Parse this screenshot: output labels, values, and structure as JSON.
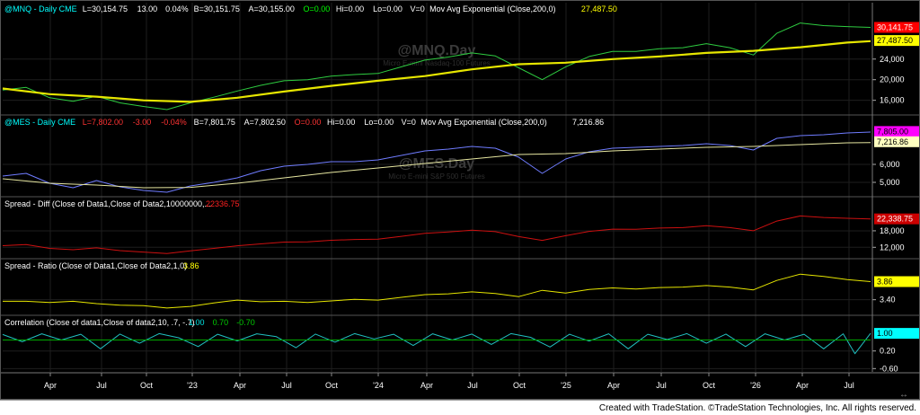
{
  "chart_data": {
    "type": "line",
    "months": [
      "Apr",
      "Jul",
      "Oct",
      "'23",
      "Apr",
      "Jul",
      "Oct",
      "'24",
      "Apr",
      "Jul",
      "Oct",
      "'25",
      "Apr",
      "Jul",
      "Oct",
      "'26",
      "Apr",
      "Jul"
    ],
    "panels": [
      {
        "title": "@MNQ - Daily  CME",
        "stats": [
          {
            "text": "L=30,154.75",
            "color": "#ffffff"
          },
          {
            "text": "13.00",
            "color": "#ffffff"
          },
          {
            "text": "0.04%",
            "color": "#ffffff"
          },
          {
            "text": "B=30,151.75",
            "color": "#ffffff"
          },
          {
            "text": "A=30,155.00",
            "color": "#ffffff"
          },
          {
            "text": "O=0.00",
            "color": "#00ff00"
          },
          {
            "text": "Hi=0.00",
            "color": "#ffffff"
          },
          {
            "text": "Lo=0.00",
            "color": "#ffffff"
          },
          {
            "text": "V=0",
            "color": "#ffffff"
          },
          {
            "text": "Mov Avg Exponential (Close,200,0)",
            "color": "#ffffff"
          },
          {
            "text": "27,487.50",
            "color": "#ffff00"
          }
        ],
        "watermark": "@MNQ.Day",
        "watermark_sub": "Micro E-mini Nasdaq-100 Futures",
        "series": [
          {
            "name": "@MNQ",
            "color": "#2ecc40",
            "x": [
              0,
              6,
              12,
              18,
              24,
              30,
              36,
              42,
              48,
              54,
              60,
              66,
              72,
              78,
              84,
              90,
              96,
              102,
              108,
              114,
              120,
              126,
              132,
              138,
              144,
              150,
              156,
              162,
              168,
              174,
              180,
              186,
              192,
              198,
              204,
              210,
              216,
              222
            ],
            "y": [
              18000,
              18500,
              16500,
              15800,
              16800,
              15500,
              14800,
              14200,
              15500,
              16600,
              17800,
              18900,
              19800,
              20000,
              20700,
              21000,
              21200,
              22500,
              23800,
              24400,
              25200,
              24600,
              22300,
              20000,
              22500,
              24500,
              25500,
              25500,
              26000,
              26200,
              27000,
              26200,
              24800,
              29000,
              31000,
              30500,
              30300,
              30150
            ]
          },
          {
            "name": "Mov Avg Exponential (Close,200,0)",
            "color": "#e6e600",
            "x": [
              0,
              12,
              24,
              36,
              48,
              60,
              72,
              84,
              96,
              108,
              120,
              132,
              144,
              156,
              168,
              180,
              192,
              204,
              216,
              222
            ],
            "y": [
              18300,
              17200,
              16700,
              16000,
              15700,
              16500,
              17700,
              18800,
              19800,
              20700,
              22000,
              23000,
              23300,
              24000,
              24500,
              25200,
              25600,
              26300,
              27200,
              27487.5
            ]
          }
        ],
        "ylim": [
          13500,
          32500
        ],
        "ticks": [
          {
            "label": "24,000",
            "v": 24000
          },
          {
            "label": "20,000",
            "v": 20000
          },
          {
            "label": "16,000",
            "v": 16000
          }
        ],
        "boxes": [
          {
            "text": "30,141.75",
            "v": 30150,
            "bg": "#ff0000",
            "fg": "#ffffff"
          },
          {
            "text": "27,487.50",
            "v": 27600,
            "bg": "#ffff00",
            "fg": "#000000"
          }
        ]
      },
      {
        "title": "@MES - Daily  CME",
        "stats": [
          {
            "text": "L=7,802.00",
            "color": "#ff3333"
          },
          {
            "text": "-3.00",
            "color": "#ff3333"
          },
          {
            "text": "-0.04%",
            "color": "#ff3333"
          },
          {
            "text": "B=7,801.75",
            "color": "#ffffff"
          },
          {
            "text": "A=7,802.50",
            "color": "#ffffff"
          },
          {
            "text": "O=0.00",
            "color": "#ff3333"
          },
          {
            "text": "Hi=0.00",
            "color": "#ffffff"
          },
          {
            "text": "Lo=0.00",
            "color": "#ffffff"
          },
          {
            "text": "V=0",
            "color": "#ffffff"
          },
          {
            "text": "Mov Avg Exponential (Close,200,0)",
            "color": "#ffffff"
          },
          {
            "text": "7,216.86",
            "color": "#ffffff"
          }
        ],
        "watermark": "@MES.Day",
        "watermark_sub": "Micro E-mini S&P 500 Futures",
        "series": [
          {
            "name": "@MES",
            "color": "#6f7cff",
            "x": [
              0,
              6,
              12,
              18,
              24,
              30,
              36,
              42,
              48,
              54,
              60,
              66,
              72,
              78,
              84,
              90,
              96,
              102,
              108,
              114,
              120,
              126,
              132,
              138,
              144,
              150,
              156,
              162,
              168,
              174,
              180,
              186,
              192,
              198,
              204,
              210,
              216,
              222
            ],
            "y": [
              5350,
              5500,
              4950,
              4700,
              5100,
              4750,
              4550,
              4450,
              4800,
              5000,
              5250,
              5650,
              5900,
              6000,
              6150,
              6150,
              6250,
              6500,
              6750,
              6850,
              7000,
              6900,
              6400,
              5500,
              6300,
              6700,
              6900,
              6950,
              7000,
              7050,
              7150,
              7050,
              6800,
              7450,
              7600,
              7650,
              7750,
              7802
            ]
          },
          {
            "name": "Mov Avg Exponential (Close,200,0)",
            "color": "#e6e6a0",
            "x": [
              0,
              12,
              24,
              36,
              48,
              60,
              72,
              84,
              96,
              108,
              120,
              132,
              144,
              156,
              168,
              180,
              192,
              204,
              216,
              222
            ],
            "y": [
              5200,
              4950,
              4850,
              4700,
              4720,
              4950,
              5250,
              5550,
              5800,
              6050,
              6300,
              6550,
              6600,
              6750,
              6850,
              6950,
              7000,
              7100,
              7200,
              7216.86
            ]
          }
        ],
        "ylim": [
          4300,
          8000
        ],
        "ticks": [
          {
            "label": "6,000",
            "v": 6000
          },
          {
            "label": "5,000",
            "v": 5000
          }
        ],
        "boxes": [
          {
            "text": "7,805.00",
            "v": 7830,
            "bg": "#ff00ff",
            "fg": "#000000"
          },
          {
            "text": "7,216.86",
            "v": 7260,
            "bg": "#ffffc0",
            "fg": "#000000"
          }
        ]
      },
      {
        "title": "Spread - Diff (Close of Data1,Close of Data2,10000000,...",
        "stats": [
          {
            "text": "22336.75",
            "color": "#ff2020"
          }
        ],
        "series": [
          {
            "name": "Spread - Diff",
            "color": "#cc1010",
            "x": [
              0,
              6,
              12,
              18,
              24,
              30,
              36,
              42,
              48,
              54,
              60,
              66,
              72,
              78,
              84,
              90,
              96,
              102,
              108,
              114,
              120,
              126,
              132,
              138,
              144,
              150,
              156,
              162,
              168,
              174,
              180,
              186,
              192,
              198,
              204,
              210,
              216,
              222
            ],
            "y": [
              12600,
              13000,
              11600,
              11100,
              11800,
              10800,
              10250,
              9750,
              10700,
              11600,
              12550,
              13250,
              13900,
              14000,
              14550,
              14850,
              14950,
              16000,
              17050,
              17550,
              18200,
              17700,
              15900,
              14500,
              16200,
              17800,
              18600,
              18550,
              19000,
              19150,
              19850,
              19150,
              18000,
              21550,
              23400,
              22850,
              22550,
              22340
            ]
          }
        ],
        "ylim": [
          8500,
          25500
        ],
        "ticks": [
          {
            "label": "18,000",
            "v": 18000
          },
          {
            "label": "12,000",
            "v": 12000
          }
        ],
        "boxes": [
          {
            "text": "22,338.75",
            "v": 22340,
            "bg": "#cc0000",
            "fg": "#ffffff"
          }
        ]
      },
      {
        "title": "Spread - Ratio (Close of Data1,Close of Data2,1,0)",
        "stats": [
          {
            "text": "3.86",
            "color": "#ffff00"
          }
        ],
        "series": [
          {
            "name": "Spread - Ratio",
            "color": "#e6e600",
            "x": [
              0,
              6,
              12,
              18,
              24,
              30,
              36,
              42,
              48,
              54,
              60,
              66,
              72,
              78,
              84,
              90,
              96,
              102,
              108,
              114,
              120,
              126,
              132,
              138,
              144,
              150,
              156,
              162,
              168,
              174,
              180,
              186,
              192,
              198,
              204,
              210,
              216,
              222
            ],
            "y": [
              3.36,
              3.36,
              3.33,
              3.36,
              3.3,
              3.26,
              3.25,
              3.19,
              3.23,
              3.32,
              3.39,
              3.35,
              3.36,
              3.33,
              3.37,
              3.41,
              3.39,
              3.46,
              3.53,
              3.55,
              3.6,
              3.56,
              3.48,
              3.64,
              3.57,
              3.66,
              3.7,
              3.67,
              3.71,
              3.72,
              3.76,
              3.72,
              3.65,
              3.89,
              4.05,
              3.99,
              3.91,
              3.86
            ]
          }
        ],
        "ylim": [
          3.05,
          4.1
        ],
        "ticks": [
          {
            "label": "3.40",
            "v": 3.4
          }
        ],
        "boxes": [
          {
            "text": "3.86",
            "v": 3.86,
            "bg": "#ffff00",
            "fg": "#000000"
          }
        ]
      },
      {
        "title": "Correlation (Close of data1,Close of data2,10, .7, -.7)",
        "stats": [
          {
            "text": "1.00",
            "color": "#00e5e5"
          },
          {
            "text": "0.70",
            "color": "#00cc00"
          },
          {
            "text": "-0.70",
            "color": "#00cc00"
          }
        ],
        "series": [
          {
            "name": "Correlation",
            "color": "#20c0c0",
            "x": [
              0,
              5,
              10,
              15,
              20,
              25,
              30,
              35,
              40,
              45,
              50,
              55,
              60,
              65,
              70,
              75,
              80,
              85,
              90,
              95,
              100,
              105,
              110,
              115,
              120,
              125,
              130,
              135,
              140,
              145,
              150,
              155,
              160,
              165,
              170,
              175,
              180,
              185,
              190,
              195,
              200,
              205,
              210,
              215,
              218,
              222
            ],
            "y": [
              0.95,
              0.62,
              0.98,
              0.7,
              0.96,
              0.3,
              0.97,
              0.55,
              0.99,
              0.8,
              0.4,
              0.96,
              0.66,
              0.98,
              0.85,
              0.35,
              0.97,
              0.6,
              0.99,
              0.75,
              0.96,
              0.45,
              0.98,
              0.7,
              0.97,
              0.5,
              0.99,
              0.82,
              0.38,
              0.96,
              0.65,
              0.98,
              0.3,
              0.96,
              0.72,
              0.99,
              0.55,
              0.97,
              0.4,
              0.98,
              0.7,
              0.96,
              0.3,
              0.98,
              0.08,
              1.0
            ]
          },
          {
            "name": "0.70",
            "color": "#00aa00",
            "x": [
              0,
              222
            ],
            "y": [
              0.7,
              0.7
            ]
          }
        ],
        "ylim": [
          -0.75,
          1.25
        ],
        "ticks": [
          {
            "label": "0.20",
            "v": 0.2
          },
          {
            "label": "-0.60",
            "v": -0.6
          }
        ],
        "boxes": [
          {
            "text": "1.00",
            "v": 1.0,
            "bg": "#00ffff",
            "fg": "#000000"
          }
        ]
      }
    ]
  },
  "footer": {
    "text": "Created with TradeStation. ©TradeStation Technologies, Inc. All rights reserved."
  }
}
